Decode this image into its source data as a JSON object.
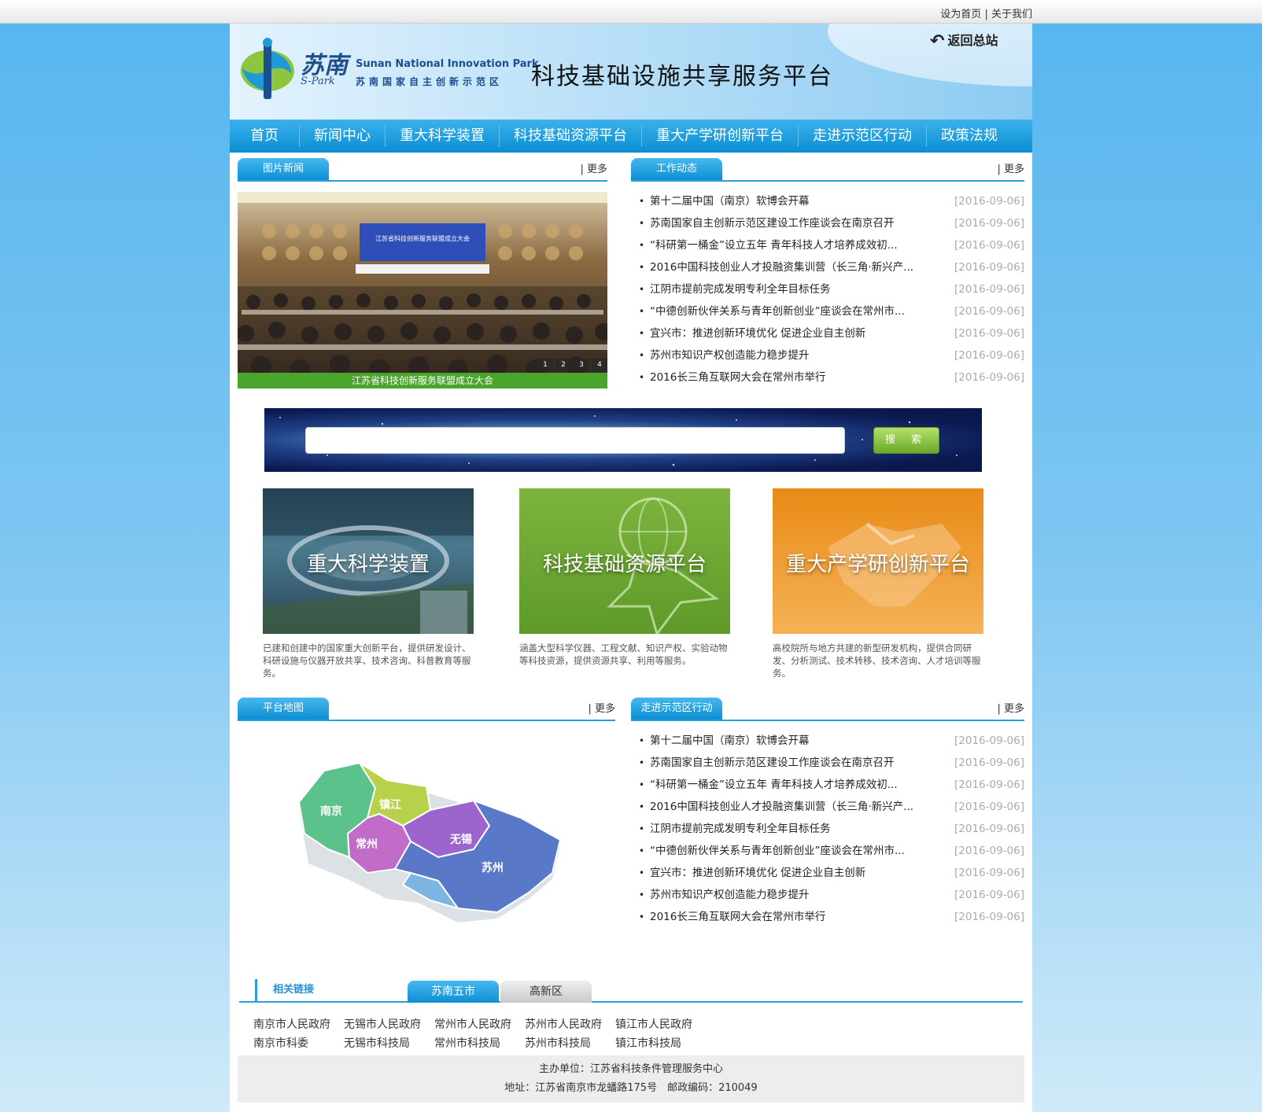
{
  "top_links": {
    "set_home": "设为首页",
    "separator": "|",
    "about": "关于我们"
  },
  "header": {
    "logo_cn": "苏南",
    "logo_sub": "S-Park",
    "logo_en": "Sunan National Innovation Park",
    "logo_zh": "苏南国家自主创新示范区",
    "title": "科技基础设施共享服务平台",
    "back_label": "返回总站"
  },
  "nav": [
    "首页",
    "新闻中心",
    "重大科学装置",
    "科技基础资源平台",
    "重大产学研创新平台",
    "走进示范区行动",
    "政策法规"
  ],
  "more_label": "| 更多",
  "picture_news": {
    "title": "图片新闻",
    "caption": "江苏省科技创新服务联盟成立大会",
    "dots": [
      "1",
      "2",
      "3",
      "4"
    ],
    "banner_text": "江苏省科技创新服务联盟成立大会"
  },
  "work_news": {
    "title": "工作动态",
    "items": [
      {
        "title": "第十二届中国（南京）软博会开幕",
        "date": "[2016-09-06]"
      },
      {
        "title": "苏南国家自主创新示范区建设工作座谈会在南京召开",
        "date": "[2016-09-06]"
      },
      {
        "title": "“科研第一桶金”设立五年 青年科技人才培养成效初...",
        "date": "[2016-09-06]"
      },
      {
        "title": "2016中国科技创业人才投融资集训营（长三角·新兴产...",
        "date": "[2016-09-06]"
      },
      {
        "title": "江阴市提前完成发明专利全年目标任务",
        "date": "[2016-09-06]"
      },
      {
        "title": "“中德创新伙伴关系与青年创新创业”座谈会在常州市...",
        "date": "[2016-09-06]"
      },
      {
        "title": "宜兴市：推进创新环境优化 促进企业自主创新",
        "date": "[2016-09-06]"
      },
      {
        "title": "苏州市知识产权创造能力稳步提升",
        "date": "[2016-09-06]"
      },
      {
        "title": "2016长三角互联网大会在常州市举行",
        "date": "[2016-09-06]"
      }
    ]
  },
  "search": {
    "placeholder": "",
    "button": "搜 索"
  },
  "features": [
    {
      "label": "重大科学装置",
      "desc": "已建和创建中的国家重大创新平台，提供研发设计、科研设施与仪器开放共享、技术咨询、科普教育等服务。"
    },
    {
      "label": "科技基础资源平台",
      "desc": "涵盖大型科学仪器、工程文献、知识产权、实验动物等科技资源，提供资源共享、利用等服务。"
    },
    {
      "label": "重大产学研创新平台",
      "desc": "高校院所与地方共建的新型研发机构，提供合同研发、分析测试、技术转移、技术咨询、人才培训等服务。"
    }
  ],
  "platform_map": {
    "title": "平台地图",
    "cities": [
      "南京",
      "镇江",
      "常州",
      "无锡",
      "苏州"
    ]
  },
  "action_news": {
    "title": "走进示范区行动",
    "items": [
      {
        "title": "第十二届中国（南京）软博会开幕",
        "date": "[2016-09-06]"
      },
      {
        "title": "苏南国家自主创新示范区建设工作座谈会在南京召开",
        "date": "[2016-09-06]"
      },
      {
        "title": "“科研第一桶金”设立五年 青年科技人才培养成效初...",
        "date": "[2016-09-06]"
      },
      {
        "title": "2016中国科技创业人才投融资集训营（长三角·新兴产...",
        "date": "[2016-09-06]"
      },
      {
        "title": "江阴市提前完成发明专利全年目标任务",
        "date": "[2016-09-06]"
      },
      {
        "title": "“中德创新伙伴关系与青年创新创业”座谈会在常州市...",
        "date": "[2016-09-06]"
      },
      {
        "title": "宜兴市：推进创新环境优化 促进企业自主创新",
        "date": "[2016-09-06]"
      },
      {
        "title": "苏州市知识产权创造能力稳步提升",
        "date": "[2016-09-06]"
      },
      {
        "title": "2016长三角互联网大会在常州市举行",
        "date": "[2016-09-06]"
      }
    ]
  },
  "links": {
    "title": "相关链接",
    "tabs": [
      "苏南五市",
      "高新区"
    ],
    "row1": [
      "南京市人民政府",
      "无锡市人民政府",
      "常州市人民政府",
      "苏州市人民政府",
      "镇江市人民政府"
    ],
    "row2": [
      "南京市科委",
      "无锡市科技局",
      "常州市科技局",
      "苏州市科技局",
      "镇江市科技局"
    ]
  },
  "footer": {
    "sponsor": "主办单位：江苏省科技条件管理服务中心",
    "address": "地址：江苏省南京市龙蟠路175号　邮政编码：210049"
  },
  "colors": {
    "nav_blue": "#0a8ed3",
    "caption_green": "#4aa52c",
    "date_gray": "#aaaaaa"
  }
}
